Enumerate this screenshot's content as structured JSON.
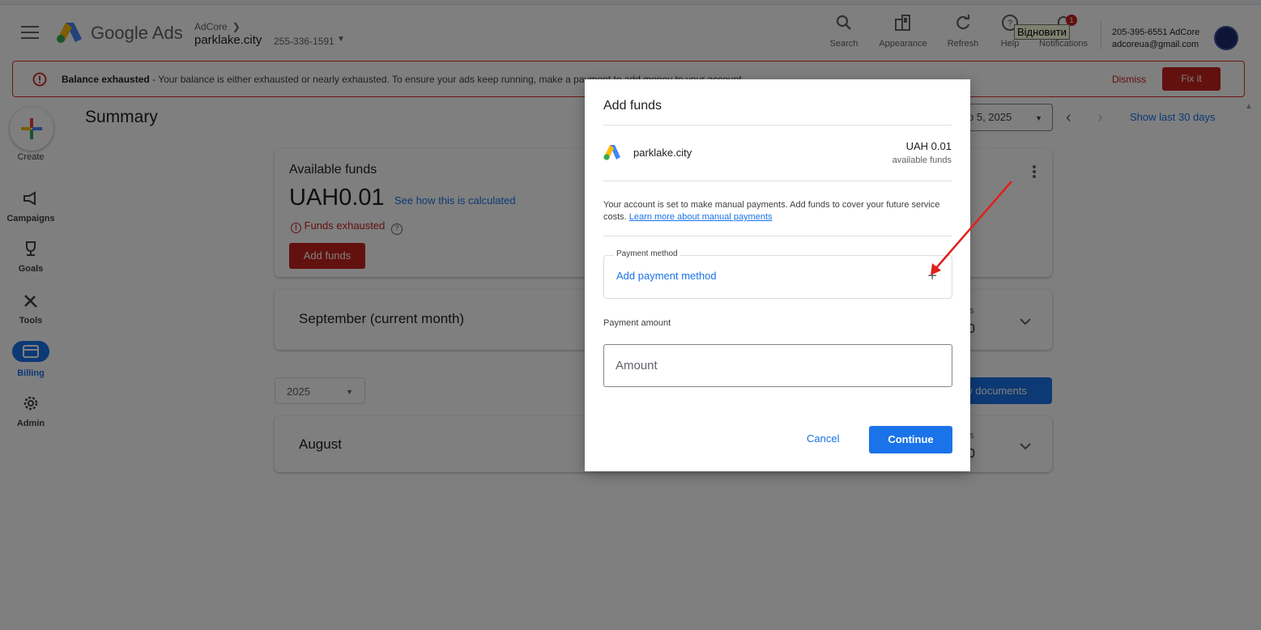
{
  "header": {
    "brand": "Google Ads",
    "breadcrumb_parent": "AdCore",
    "account_name": "parklake.city",
    "account_id": "255-336-1591",
    "tools": [
      {
        "label": "Search",
        "icon": "search-icon"
      },
      {
        "label": "Appearance",
        "icon": "appearance-icon"
      },
      {
        "label": "Refresh",
        "icon": "refresh-icon"
      },
      {
        "label": "Help",
        "icon": "help-icon"
      },
      {
        "label": "Notifications",
        "icon": "bell-icon"
      }
    ],
    "notification_count": "1",
    "tooltip": "Відновити",
    "user_phone_line": "205-395-6551 AdCore",
    "user_email": "adcoreua@gmail.com"
  },
  "alert": {
    "title": "Balance exhausted",
    "message": " - Your balance is either exhausted or nearly exhausted. To ensure your ads keep running, make a payment to add money to your account.",
    "dismiss_label": "Dismiss",
    "fix_label": "Fix it"
  },
  "sidebar": {
    "create_label": "Create",
    "items": [
      {
        "label": "Campaigns",
        "icon": "megaphone-icon"
      },
      {
        "label": "Goals",
        "icon": "trophy-icon"
      },
      {
        "label": "Tools",
        "icon": "tools-icon"
      },
      {
        "label": "Billing",
        "icon": "credit-card-icon",
        "active": true
      },
      {
        "label": "Admin",
        "icon": "gear-icon"
      }
    ]
  },
  "main": {
    "title": "Summary",
    "date_range": "p 5, 2025",
    "show_last": "Show last 30 days",
    "funds_card": {
      "title": "Available funds",
      "amount": "UAH0.01",
      "see_how": "See how this is calculated",
      "status": "Funds exhausted",
      "add_funds_label": "Add funds"
    },
    "current_month": "September (current month)",
    "current_month_stub_top": "s",
    "current_month_stub_bottom": "0",
    "year": "2025",
    "view_documents": "ew documents",
    "past_month": "August",
    "past_month_stub_top": "s",
    "past_month_stub_bottom": "0"
  },
  "dialog": {
    "title": "Add funds",
    "account": "parklake.city",
    "balance": "UAH 0.01",
    "balance_sub": "available funds",
    "info": "Your account is set to make manual payments. Add funds to cover your future service costs. ",
    "learn_more": "Learn more about manual payments",
    "payment_method_legend": "Payment method",
    "add_payment_method": "Add payment method",
    "payment_amount_label": "Payment amount",
    "amount_placeholder": "Amount",
    "cancel_label": "Cancel",
    "continue_label": "Continue"
  },
  "colors": {
    "accent_blue": "#1a73e8",
    "error_red": "#c5221f",
    "annotation_red": "#e0201b"
  }
}
